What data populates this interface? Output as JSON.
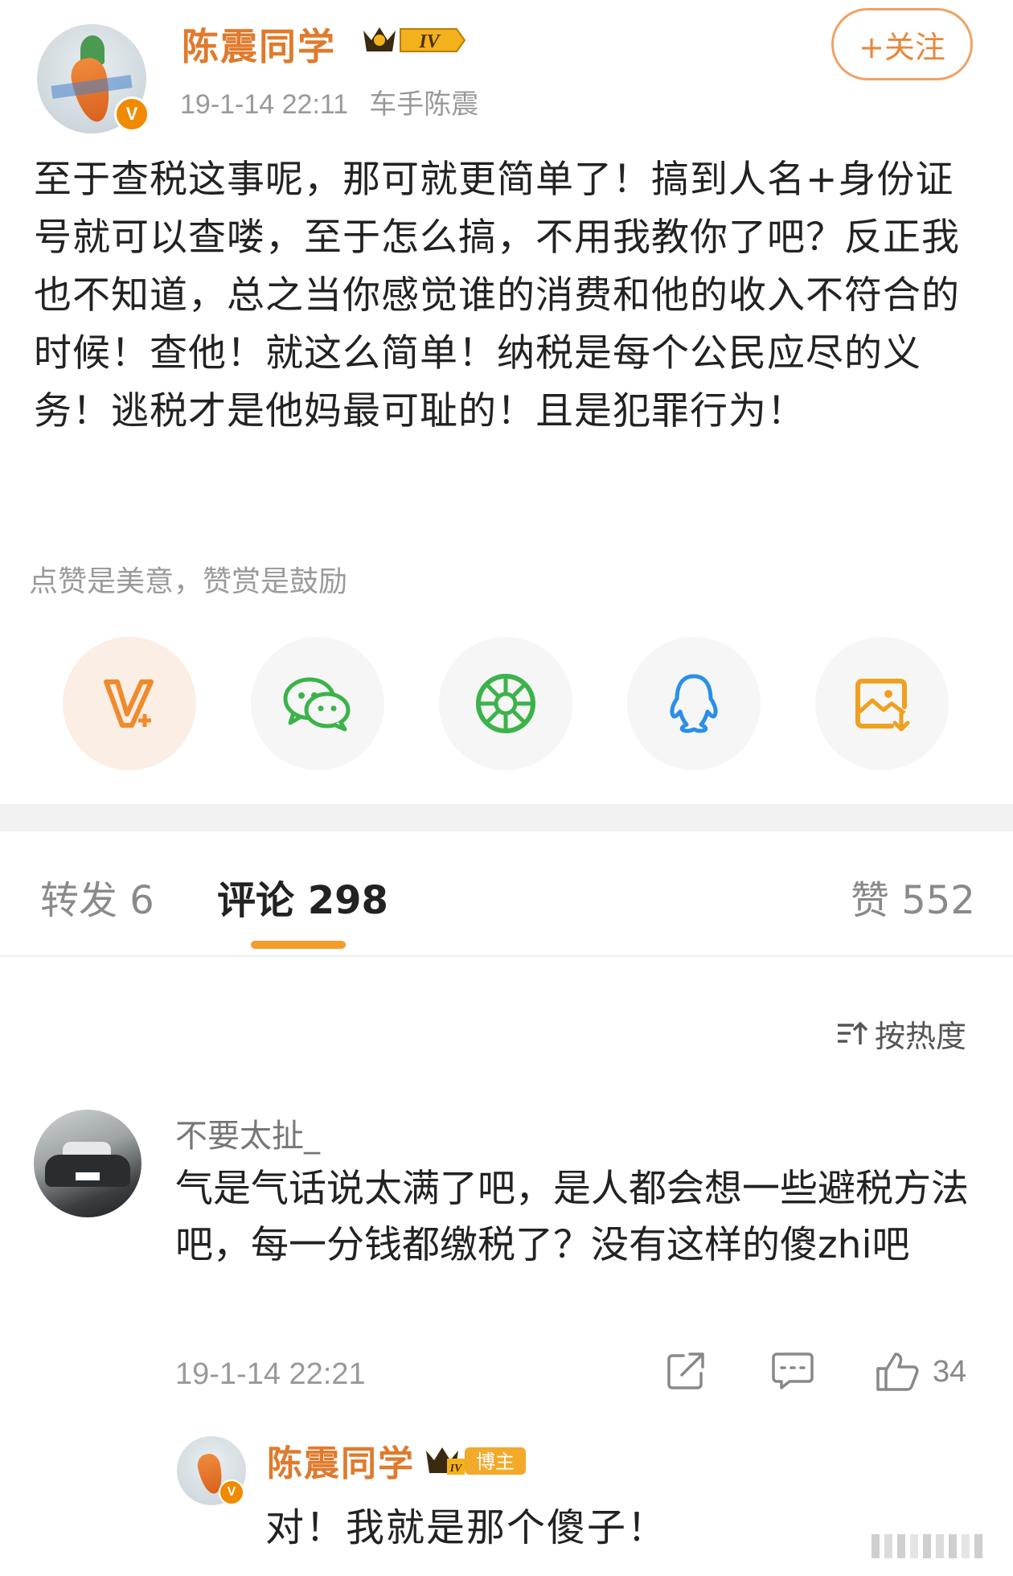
{
  "post": {
    "author": "陈震同学",
    "level_badge": "IV",
    "timestamp": "19-1-14 22:11",
    "source": "车手陈震",
    "follow_label": "+关注",
    "body": "至于查税这事呢，那可就更简单了！搞到人名+身份证号就可以查喽，至于怎么搞，不用我教你了吧？反正我也不知道，总之当你感觉谁的消费和他的收入不符合的时候！查他！就这么简单！纳税是每个公民应尽的义务！逃税才是他妈最可耻的！且是犯罪行为！",
    "tip": "点赞是美意，赞赏是鼓励"
  },
  "share": [
    {
      "icon": "weibo-vplus-icon",
      "color": "#f08a2c"
    },
    {
      "icon": "wechat-icon",
      "color": "#3bb34a"
    },
    {
      "icon": "moments-icon",
      "color": "#3bb34a"
    },
    {
      "icon": "qq-icon",
      "color": "#2a8fe6"
    },
    {
      "icon": "save-image-icon",
      "color": "#f0a020"
    }
  ],
  "tabs": {
    "repost": "转发 6",
    "comments": "评论 298",
    "likes": "赞 552"
  },
  "sort": {
    "label": "按热度"
  },
  "comment": {
    "user": "不要太扯_",
    "text": "气是气话说太满了吧，是人都会想一些避税方法吧，每一分钱都缴税了？没有这样的傻zhi吧",
    "time": "19-1-14 22:21",
    "like_count": "34"
  },
  "reply": {
    "user": "陈震同学",
    "badge": "博主",
    "badge_level": "IV",
    "text": "对！我就是那个傻子！"
  },
  "colors": {
    "accent_orange": "#e07a2c",
    "tab_indicator": "#f39b2b",
    "text_primary": "#222222",
    "text_secondary": "#999999"
  }
}
